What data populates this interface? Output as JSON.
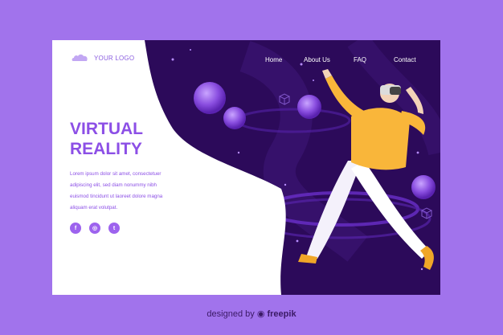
{
  "logo": {
    "text": "YOUR LOGO",
    "icon": "cloud-logo-icon"
  },
  "nav": {
    "items": [
      "Home",
      "About Us",
      "FAQ",
      "Contact"
    ]
  },
  "hero": {
    "title_line1": "VIRTUAL",
    "title_line2": "REALITY",
    "body_lines": [
      "Lorem ipsum dolor sit amet, consectetuer",
      "adipiscing elit, sed diam nonummy nibh",
      "euismod tincidunt ut laoreet dolore magna",
      "aliquam erat volutpat."
    ]
  },
  "social": [
    {
      "icon": "facebook-icon",
      "glyph": "f"
    },
    {
      "icon": "instagram-icon",
      "glyph": "◎"
    },
    {
      "icon": "twitter-icon",
      "glyph": "t"
    }
  ],
  "footer": {
    "prefix": "designed by",
    "brand": "freepik"
  },
  "colors": {
    "page_bg": "#a173ec",
    "card_dark": "#2c0a5a",
    "accent_purple": "#8c4fe6",
    "shirt_yellow": "#f9b63a"
  }
}
